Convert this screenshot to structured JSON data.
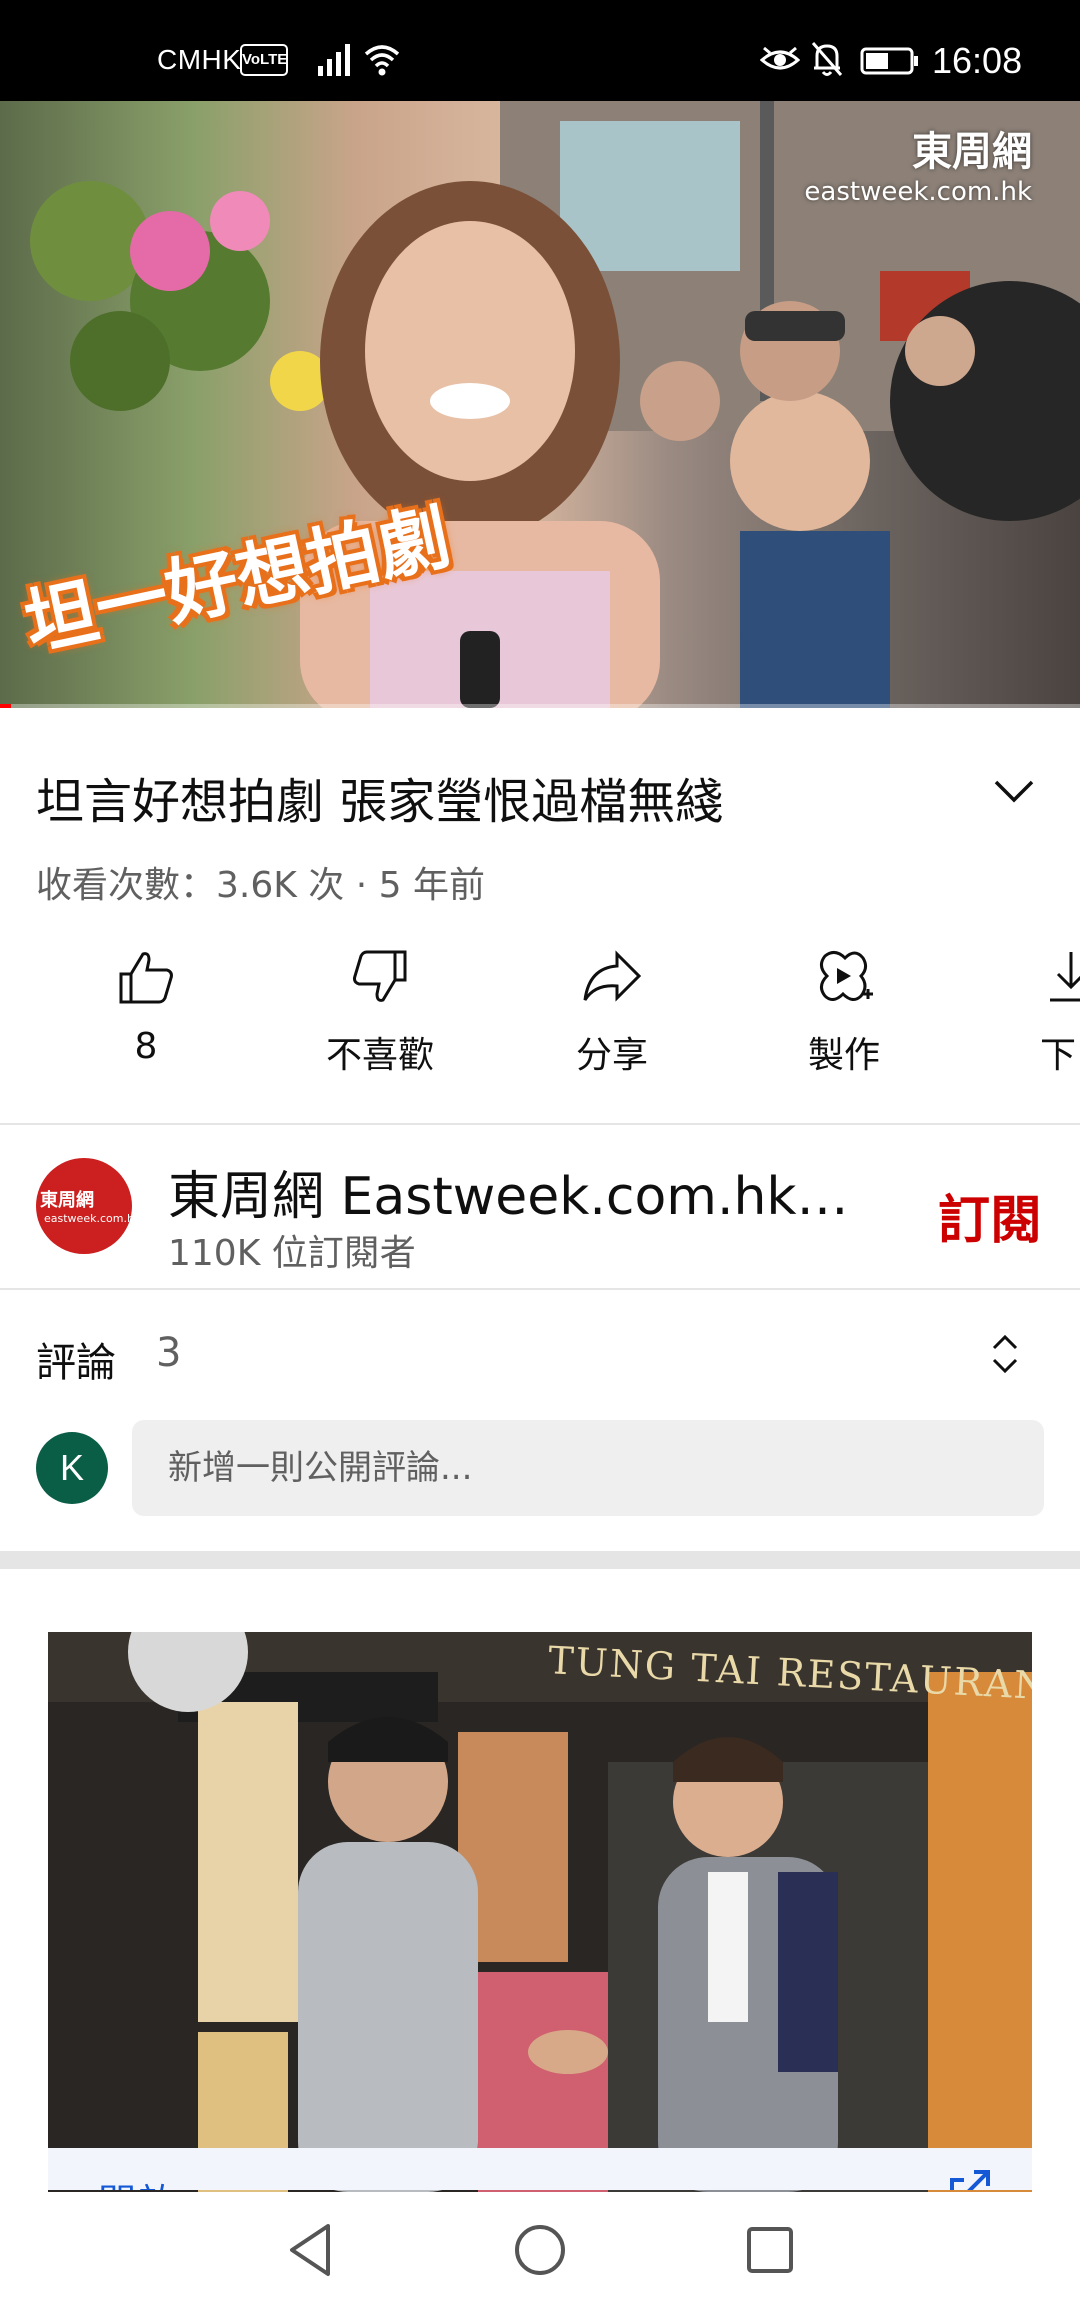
{
  "status_bar": {
    "carrier": "CMHK",
    "volte": "VoLTE",
    "time": "16:08",
    "icons": [
      "signal-icon",
      "wifi-icon",
      "eye-icon",
      "bell-off-icon",
      "battery-icon"
    ]
  },
  "video": {
    "watermark_name": "東周網",
    "watermark_url": "eastweek.com.hk",
    "caption": "坦一好想拍劇",
    "progress": 0.01
  },
  "title": "坦言好想拍劇  張家瑩恨過檔無綫",
  "meta": "收看次數：3.6K 次 · 5 年前",
  "actions": [
    {
      "label": "8",
      "icon": "thumbs-up-icon"
    },
    {
      "label": "不喜歡",
      "icon": "thumbs-down-icon"
    },
    {
      "label": "分享",
      "icon": "share-icon"
    },
    {
      "label": "製作",
      "icon": "create-icon"
    },
    {
      "label": "下",
      "icon": "download-icon"
    }
  ],
  "channel": {
    "avatar_text": "東周網",
    "avatar_sub": "eastweek.com.hk",
    "name": "東周網 Eastweek.com.hk【…",
    "subscribers": "110K 位訂閱者",
    "subscribe_label": "訂閱"
  },
  "comments": {
    "heading": "評論",
    "count": "3",
    "user_initial": "K",
    "placeholder": "新增一則公開評論..."
  },
  "ad": {
    "sign_text": "TUNG TAI RESTAURANT",
    "open_label": "開啟"
  },
  "colors": {
    "subscribe_red": "#cc0000",
    "user_avatar_green": "#0b5e46",
    "channel_avatar_red": "#cc1f1f"
  }
}
